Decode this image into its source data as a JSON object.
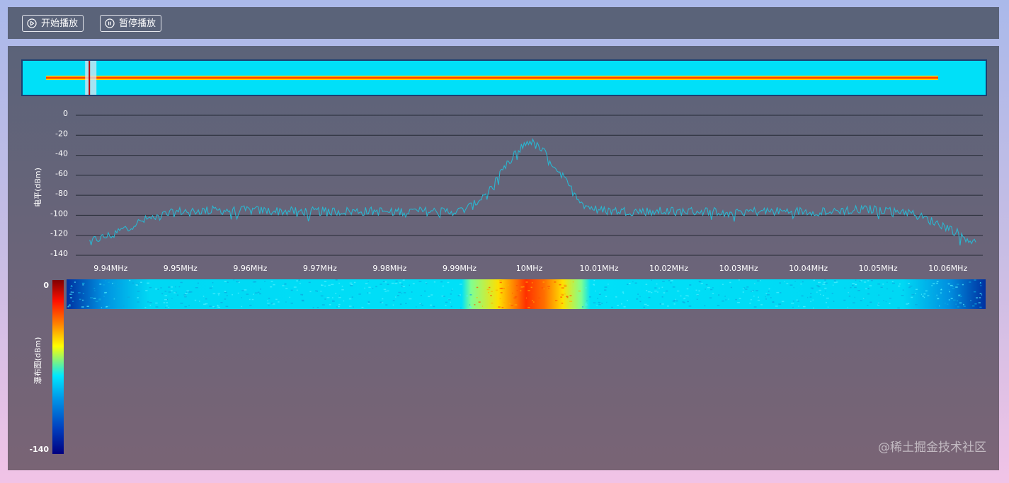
{
  "toolbar": {
    "start_label": "开始播放",
    "pause_label": "暂停播放"
  },
  "watermark": "@稀土掘金技术社区",
  "colors": {
    "line": "#2ab6d0",
    "gridline": "#252a35",
    "label": "#ffffff",
    "colormap": [
      "#000080",
      "#0050d0",
      "#00e8ff",
      "#ffff00",
      "#ff7f00",
      "#ff0000",
      "#800000"
    ]
  },
  "chart_data": {
    "type": "line",
    "spectrum": {
      "ylabel": "电平(dBm)",
      "ylim": [
        -140,
        0
      ],
      "yticks": [
        "0",
        "-20",
        "-40",
        "-60",
        "-80",
        "-100",
        "-120",
        "-140"
      ],
      "xlim": [
        9.935,
        10.065
      ],
      "xticks": [
        {
          "value": 9.94,
          "label": "9.94MHz"
        },
        {
          "value": 9.95,
          "label": "9.95MHz"
        },
        {
          "value": 9.96,
          "label": "9.96MHz"
        },
        {
          "value": 9.97,
          "label": "9.97MHz"
        },
        {
          "value": 9.98,
          "label": "9.98MHz"
        },
        {
          "value": 9.99,
          "label": "9.99MHz"
        },
        {
          "value": 10.0,
          "label": "10MHz"
        },
        {
          "value": 10.01,
          "label": "10.01MHz"
        },
        {
          "value": 10.02,
          "label": "10.02MHz"
        },
        {
          "value": 10.03,
          "label": "10.03MHz"
        },
        {
          "value": 10.04,
          "label": "10.04MHz"
        },
        {
          "value": 10.05,
          "label": "10.05MHz"
        },
        {
          "value": 10.06,
          "label": "10.06MHz"
        }
      ],
      "grid": true,
      "series": [
        {
          "x": [
            9.937,
            9.94,
            9.943,
            9.946,
            9.95,
            9.955,
            9.96,
            9.965,
            9.97,
            9.975,
            9.98,
            9.985,
            9.99,
            9.992,
            9.994,
            9.996,
            9.998,
            10.0,
            10.002,
            10.004,
            10.006,
            10.008,
            10.01,
            10.015,
            10.02,
            10.025,
            10.03,
            10.035,
            10.04,
            10.045,
            10.05,
            10.054,
            10.057,
            10.06,
            10.064
          ],
          "y": [
            -126,
            -120,
            -110,
            -102,
            -96,
            -95,
            -95,
            -96,
            -96,
            -96,
            -96,
            -96,
            -96,
            -90,
            -76,
            -58,
            -38,
            -25,
            -36,
            -54,
            -74,
            -90,
            -95,
            -96,
            -96,
            -96,
            -96,
            -96,
            -96,
            -95,
            -94,
            -96,
            -104,
            -112,
            -128
          ]
        }
      ]
    },
    "overview": {
      "marker_x": 9.944
    },
    "waterfall": {
      "ylabel": "瀑布图(dBm)",
      "colorbar_range": [
        -140,
        0
      ],
      "colorbar_ticks": [
        "0",
        "-140"
      ],
      "rows_filled_fraction": 0.17
    }
  }
}
